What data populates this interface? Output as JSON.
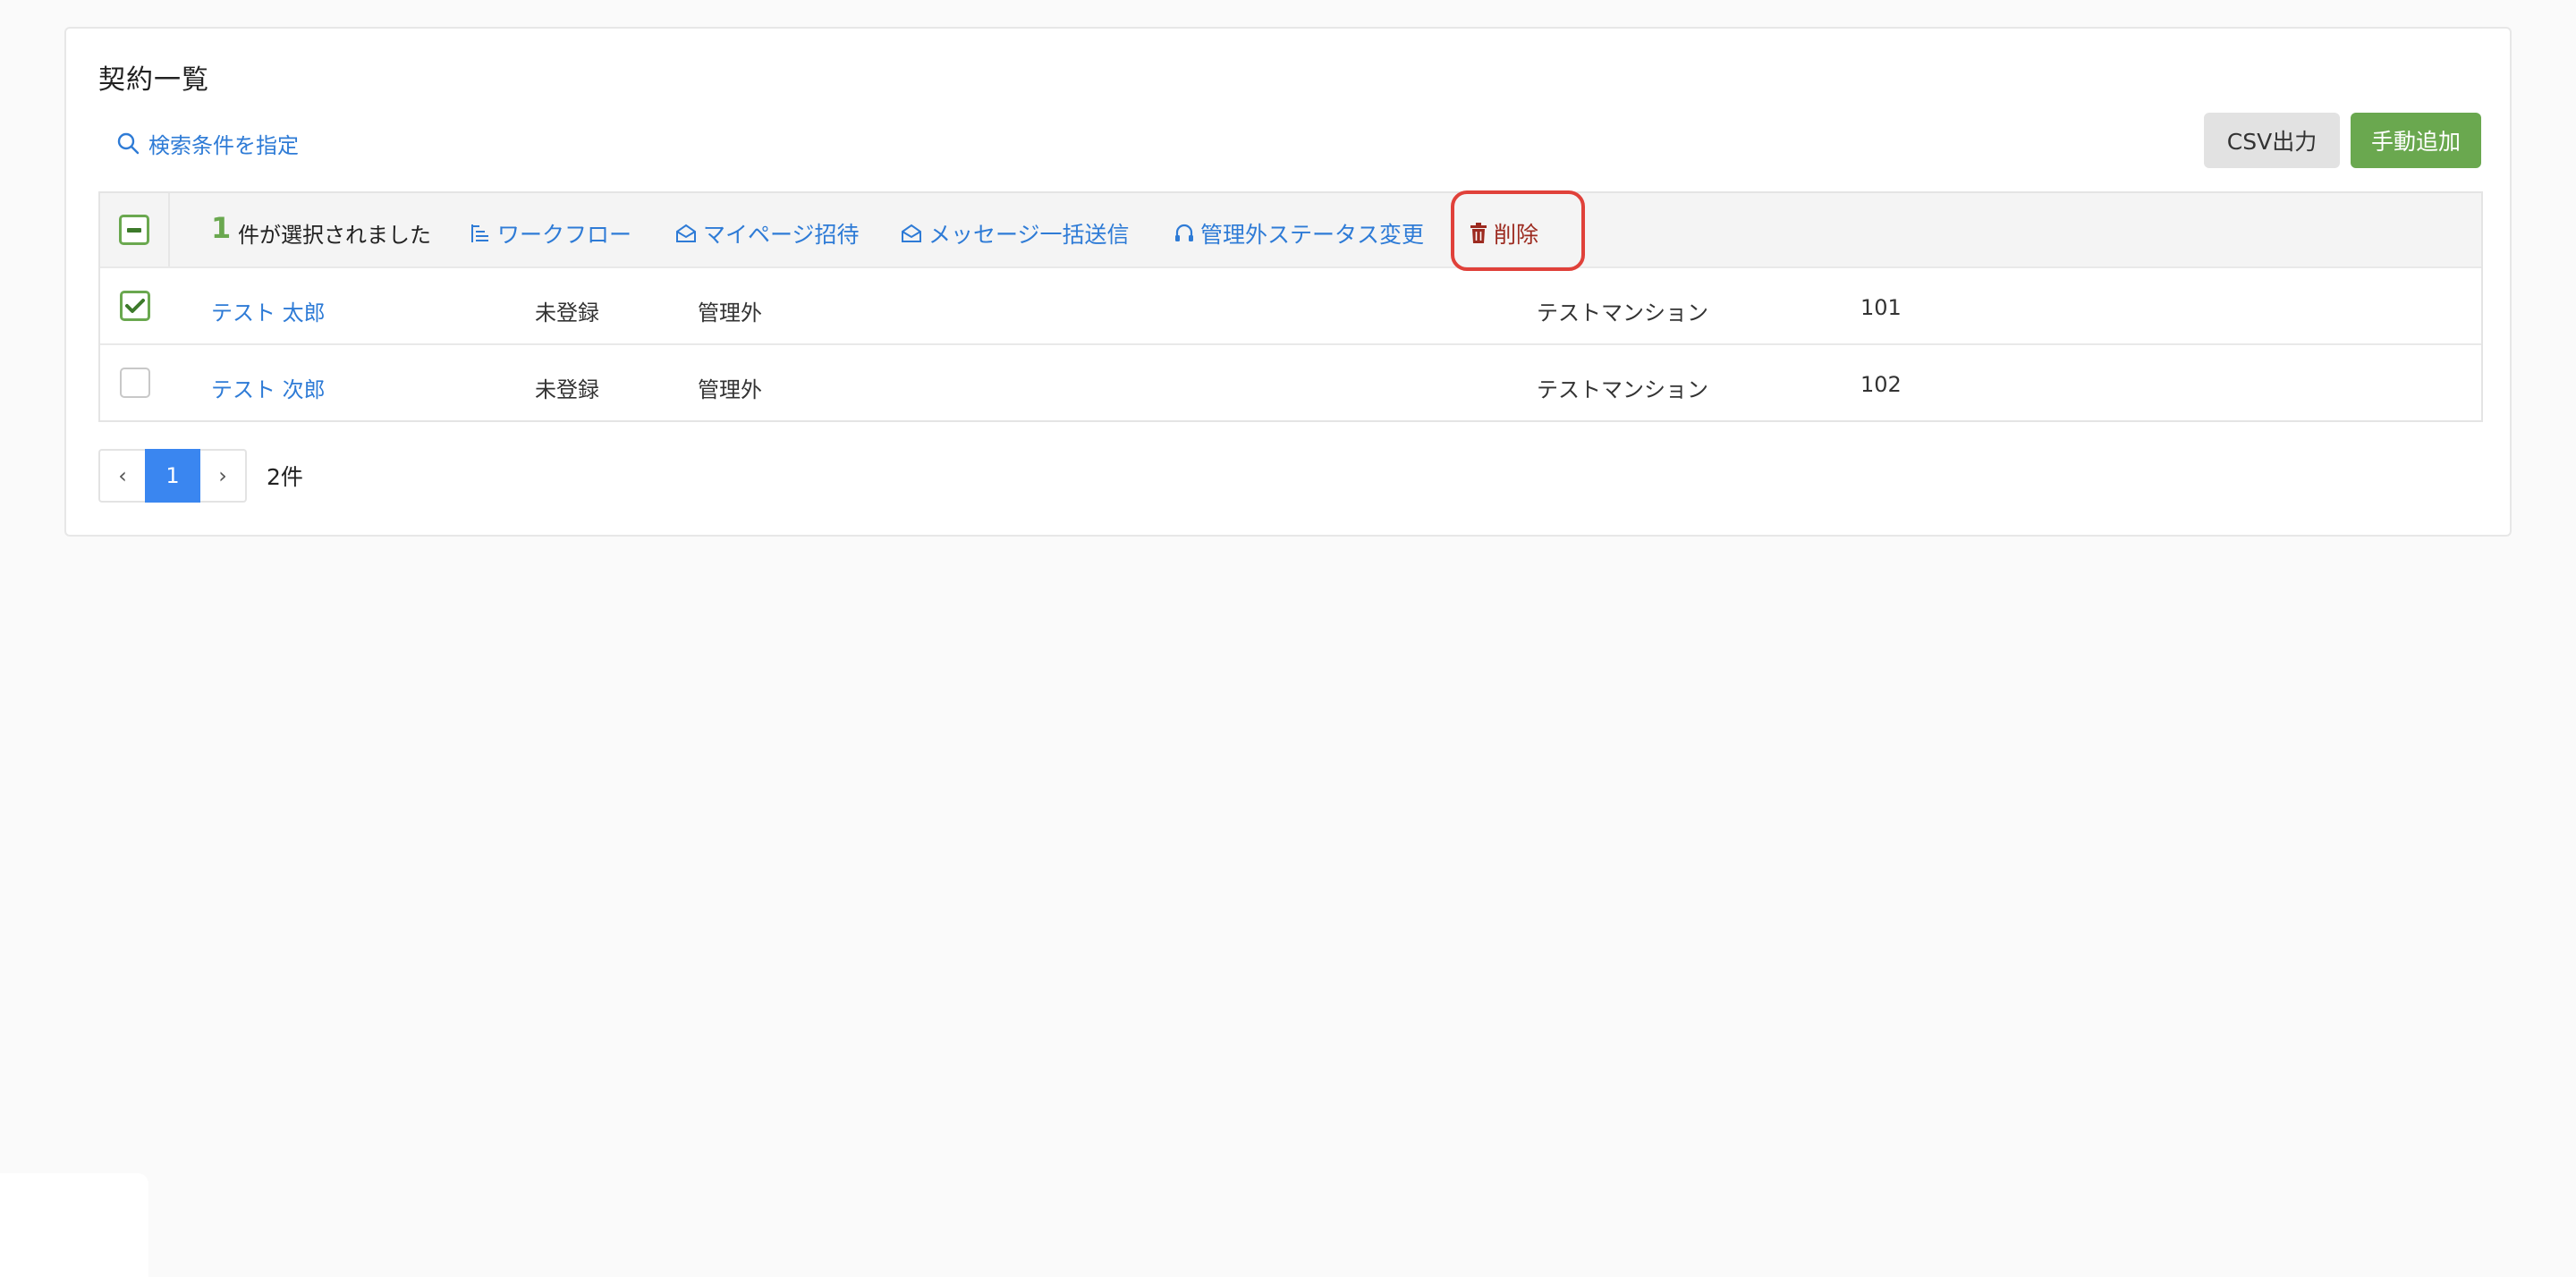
{
  "page": {
    "title": "契約一覧",
    "search_link": "検索条件を指定",
    "buttons": {
      "csv": "CSV出力",
      "add": "手動追加"
    }
  },
  "selection_bar": {
    "count": "1",
    "text": "件が選択されました",
    "actions": {
      "workflow": "ワークフロー",
      "mypage_invite": "マイページ招待",
      "bulk_message": "メッセージ一括送信",
      "status_change": "管理外ステータス変更",
      "delete": "削除"
    }
  },
  "rows": [
    {
      "checked": true,
      "name": "テスト 太郎",
      "registration": "未登録",
      "management": "管理外",
      "property": "テストマンション",
      "room": "101"
    },
    {
      "checked": false,
      "name": "テスト 次郎",
      "registration": "未登録",
      "management": "管理外",
      "property": "テストマンション",
      "room": "102"
    }
  ],
  "pagination": {
    "prev": "‹",
    "current": "1",
    "next": "›",
    "total": "2件"
  },
  "colors": {
    "accent_blue": "#2e7bd6",
    "green": "#6aa84f",
    "delete_red": "#9c2a1f",
    "highlight_red": "#e0413a"
  }
}
